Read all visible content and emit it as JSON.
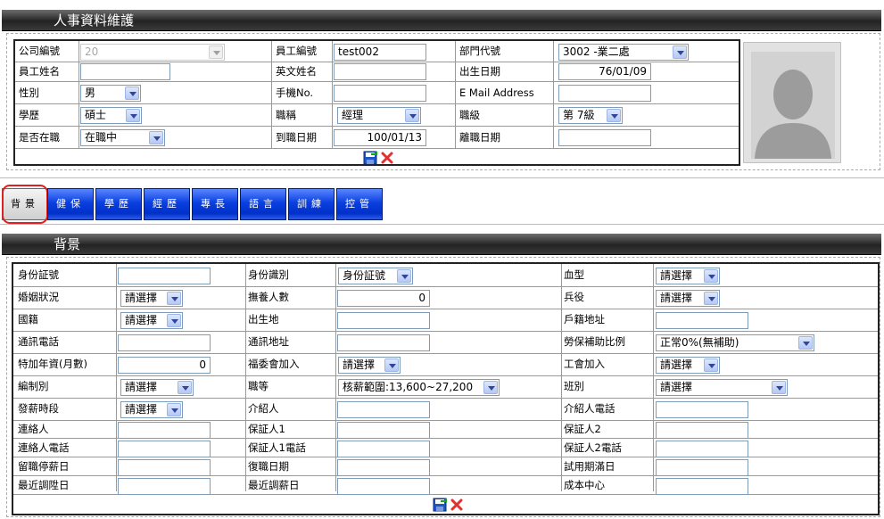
{
  "top": {
    "title": "人事資料維護",
    "fields": {
      "company_no": {
        "label": "公司編號",
        "value": "20"
      },
      "emp_no": {
        "label": "員工編號",
        "value": "test002"
      },
      "dept": {
        "label": "部門代號",
        "value": "3002 -業二處"
      },
      "emp_name": {
        "label": "員工姓名",
        "value": ""
      },
      "eng_name": {
        "label": "英文姓名",
        "value": ""
      },
      "birth": {
        "label": "出生日期",
        "value": "76/01/09"
      },
      "gender": {
        "label": "性別",
        "value": "男"
      },
      "mobile": {
        "label": "手機No.",
        "value": ""
      },
      "email": {
        "label": "E Mail Address",
        "value": ""
      },
      "education": {
        "label": "學歷",
        "value": "碩士"
      },
      "title_job": {
        "label": "職稱",
        "value": "經理"
      },
      "grade": {
        "label": "職級",
        "value": "第 7級"
      },
      "employed": {
        "label": "是否在職",
        "value": "在職中"
      },
      "hire_date": {
        "label": "到職日期",
        "value": "100/01/13"
      },
      "leave_date": {
        "label": "離職日期",
        "value": ""
      }
    }
  },
  "tabs": [
    "背景",
    "健保",
    "學歷",
    "經歷",
    "專長",
    "語言",
    "訓練",
    "控管"
  ],
  "active_tab": "背景",
  "bottom": {
    "title": "背景",
    "fields": {
      "id_no": {
        "label": "身份証號",
        "value": ""
      },
      "id_type": {
        "label": "身份識別",
        "value": "身份証號"
      },
      "blood": {
        "label": "血型",
        "value": "請選擇"
      },
      "marital": {
        "label": "婚姻狀況",
        "value": "請選擇"
      },
      "dependents": {
        "label": "撫養人數",
        "value": "0"
      },
      "military": {
        "label": "兵役",
        "value": "請選擇"
      },
      "nationality": {
        "label": "國籍",
        "value": "請選擇"
      },
      "birthplace": {
        "label": "出生地",
        "value": ""
      },
      "household_addr": {
        "label": "戶籍地址",
        "value": ""
      },
      "comm_phone": {
        "label": "通訊電話",
        "value": ""
      },
      "comm_addr": {
        "label": "通訊地址",
        "value": ""
      },
      "labor_ratio": {
        "label": "勞保補助比例",
        "value": "正常0%(無補助)"
      },
      "extra_salary": {
        "label": "特加年資(月數)",
        "value": "0"
      },
      "welfare": {
        "label": "福委會加入",
        "value": "請選擇"
      },
      "union": {
        "label": "工會加入",
        "value": "請選擇"
      },
      "staffing": {
        "label": "編制別",
        "value": "請選擇"
      },
      "rank": {
        "label": "職等",
        "value": "核薪範圍:13,600~27,200"
      },
      "shift": {
        "label": "班別",
        "value": "請選擇"
      },
      "pay_period": {
        "label": "發薪時段",
        "value": "請選擇"
      },
      "introducer": {
        "label": "介紹人",
        "value": ""
      },
      "introducer_phone": {
        "label": "介紹人電話",
        "value": ""
      },
      "contact": {
        "label": "連絡人",
        "value": ""
      },
      "guarantor1": {
        "label": "保証人1",
        "value": ""
      },
      "guarantor2": {
        "label": "保証人2",
        "value": ""
      },
      "contact_phone": {
        "label": "連絡人電話",
        "value": ""
      },
      "guarantor1_phone": {
        "label": "保証人1電話",
        "value": ""
      },
      "guarantor2_phone": {
        "label": "保証人2電話",
        "value": ""
      },
      "suspend_date": {
        "label": "留職停薪日",
        "value": ""
      },
      "reinstate_date": {
        "label": "復職日期",
        "value": ""
      },
      "probation_end": {
        "label": "試用期滿日",
        "value": ""
      },
      "last_promo": {
        "label": "最近調陞日",
        "value": ""
      },
      "last_raise": {
        "label": "最近調薪日",
        "value": ""
      },
      "cost_center": {
        "label": "成本中心",
        "value": ""
      }
    }
  }
}
